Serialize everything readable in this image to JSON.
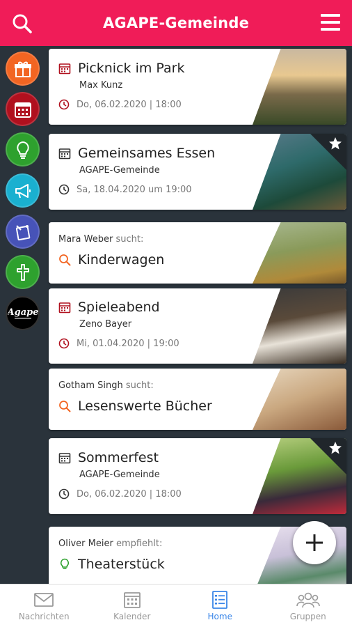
{
  "header": {
    "title": "AGAPE-Gemeinde"
  },
  "sidebar": {
    "categories": [
      {
        "name": "gift",
        "color": "#f26522"
      },
      {
        "name": "calendar",
        "color": "#b0101e"
      },
      {
        "name": "lightbulb",
        "color": "#2ea12e"
      },
      {
        "name": "megaphone",
        "color": "#1ab0d0"
      },
      {
        "name": "note",
        "color": "#4753b8"
      },
      {
        "name": "cross",
        "color": "#2ea12e"
      },
      {
        "name": "agape-logo",
        "logo_text": "Agape"
      }
    ]
  },
  "feed": {
    "cards": [
      {
        "type": "event",
        "title": "Picknick im Park",
        "organizer": "Max Kunz",
        "date": "Do, 06.02.2020 | 18:00",
        "featured": false
      },
      {
        "type": "event",
        "title": "Gemeinsames Essen",
        "organizer": "AGAPE-Gemeinde",
        "date": "Sa, 18.04.2020 um 19:00",
        "featured": true
      },
      {
        "type": "search",
        "user": "Mara Weber",
        "verb": "sucht:",
        "title": "Kinderwagen"
      },
      {
        "type": "event",
        "title": "Spieleabend",
        "organizer": "Zeno Bayer",
        "date": "Mi, 01.04.2020 | 19:00",
        "featured": false
      },
      {
        "type": "search",
        "user": "Gotham Singh",
        "verb": "sucht:",
        "title": "Lesenswerte Bücher"
      },
      {
        "type": "event",
        "title": "Sommerfest",
        "organizer": "AGAPE-Gemeinde",
        "date": "Do, 06.02.2020 | 18:00",
        "featured": true
      },
      {
        "type": "recommend",
        "user": "Oliver Meier",
        "verb": "empfiehlt:",
        "title": "Theaterstück"
      }
    ]
  },
  "bottom_nav": {
    "items": [
      {
        "label": "Nachrichten",
        "active": false
      },
      {
        "label": "Kalender",
        "active": false
      },
      {
        "label": "Home",
        "active": true
      },
      {
        "label": "Gruppen",
        "active": false
      }
    ]
  },
  "colors": {
    "brand": "#f01c58",
    "dark": "#2a333b",
    "active": "#3a86e8",
    "event_icon": "#b0101e",
    "search_icon": "#f26522",
    "recommend_icon": "#2ea12e"
  }
}
